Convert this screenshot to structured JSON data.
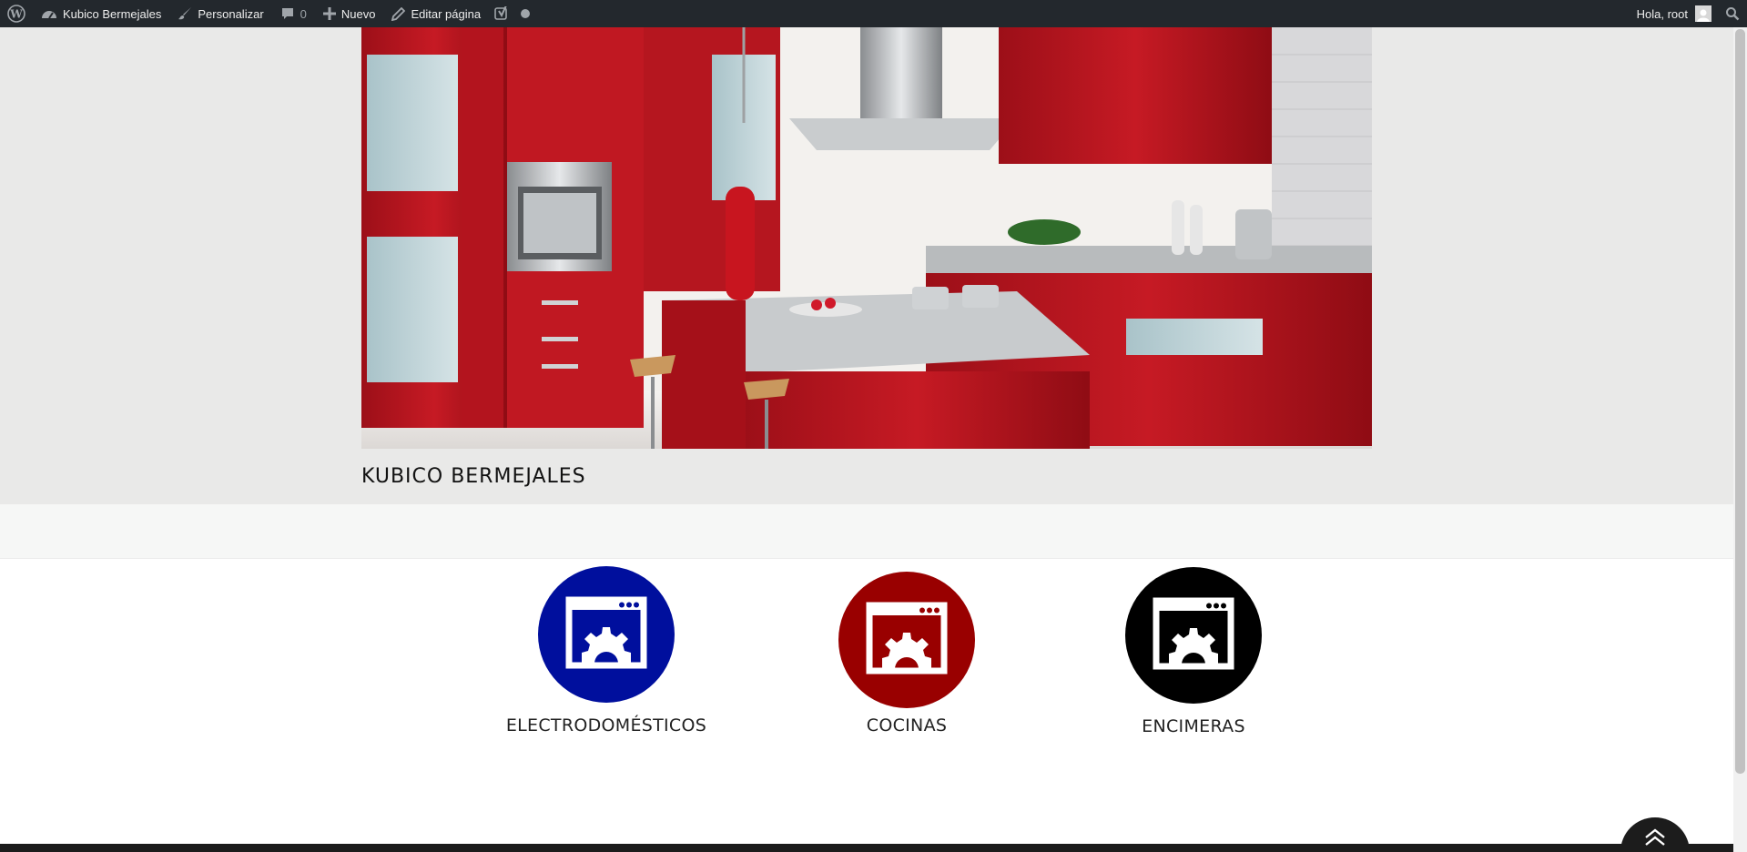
{
  "adminbar": {
    "site_name": "Kubico Bermejales",
    "customize": "Personalizar",
    "comments_count": "0",
    "new": "Nuevo",
    "edit_page": "Editar página",
    "greeting": "Hola, root"
  },
  "header": {
    "site_title": "KUBICO BERMEJALES"
  },
  "features": [
    {
      "label": "ELECTRODOMÉSTICOS",
      "color": "#000f9d",
      "icon": "browser-settings-icon"
    },
    {
      "label": "COCINAS",
      "color": "#990000",
      "icon": "browser-settings-icon"
    },
    {
      "label": "ENCIMERAS",
      "color": "#000000",
      "icon": "browser-settings-icon"
    }
  ],
  "colors": {
    "adminbar": "#23282d",
    "header_bg": "#e9e9e8",
    "kitchen_red": "#b0141d"
  }
}
